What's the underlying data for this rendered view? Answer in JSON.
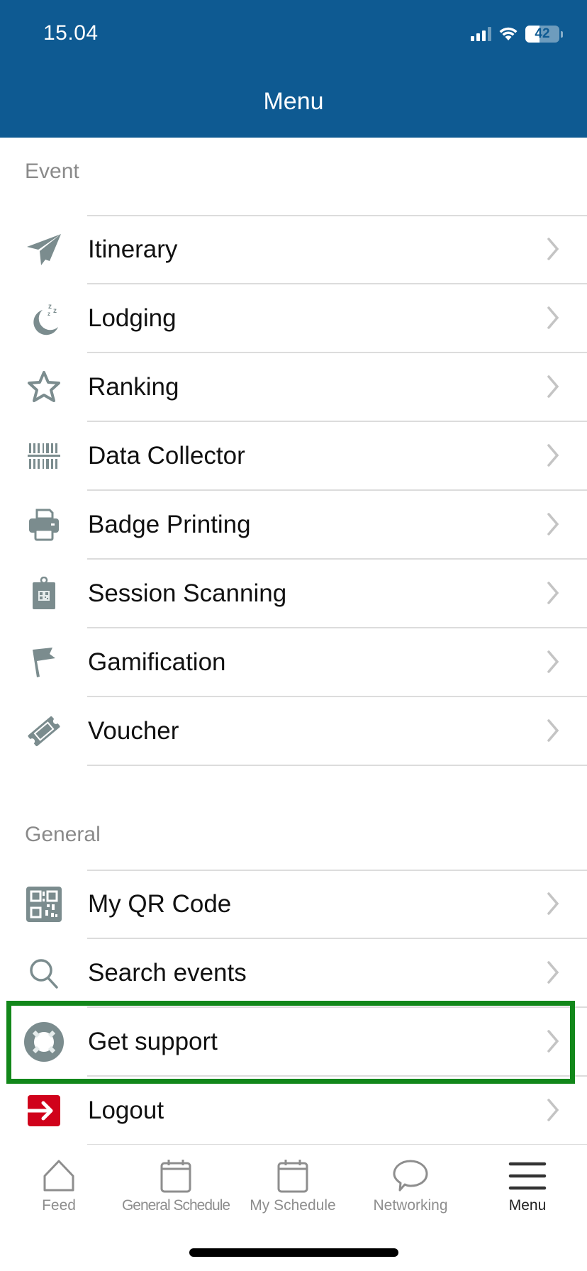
{
  "status_bar": {
    "time": "15.04",
    "battery_percent": 42,
    "battery_label": "42"
  },
  "header": {
    "title": "Menu"
  },
  "sections": [
    {
      "label": "Event",
      "items": [
        {
          "label": "Itinerary",
          "icon": "paper-plane-icon"
        },
        {
          "label": "Lodging",
          "icon": "moon-sleep-icon"
        },
        {
          "label": "Ranking",
          "icon": "star-icon"
        },
        {
          "label": "Data Collector",
          "icon": "barcode-icon"
        },
        {
          "label": "Badge Printing",
          "icon": "printer-icon"
        },
        {
          "label": "Session Scanning",
          "icon": "clipboard-qr-icon"
        },
        {
          "label": "Gamification",
          "icon": "flag-icon"
        },
        {
          "label": "Voucher",
          "icon": "ticket-icon"
        }
      ]
    },
    {
      "label": "General",
      "items": [
        {
          "label": "My QR Code",
          "icon": "qr-code-icon"
        },
        {
          "label": "Search events",
          "icon": "search-icon"
        },
        {
          "label": "Get support",
          "icon": "lifebuoy-icon",
          "highlighted": true
        },
        {
          "label": "Logout",
          "icon": "logout-icon"
        }
      ]
    }
  ],
  "tabbar": {
    "tabs": [
      {
        "label": "Feed",
        "icon": "home-icon",
        "active": false
      },
      {
        "label": "General Schedule",
        "icon": "calendar-icon",
        "active": false
      },
      {
        "label": "My Schedule",
        "icon": "calendar-icon",
        "active": false
      },
      {
        "label": "Networking",
        "icon": "chat-bubble-icon",
        "active": false
      },
      {
        "label": "Menu",
        "icon": "hamburger-menu-icon",
        "active": true
      }
    ]
  },
  "colors": {
    "header_bg": "#0e5a92",
    "icon_gray": "#7b8c8e",
    "logout_red": "#d0021b",
    "highlight_green": "#12871a"
  }
}
